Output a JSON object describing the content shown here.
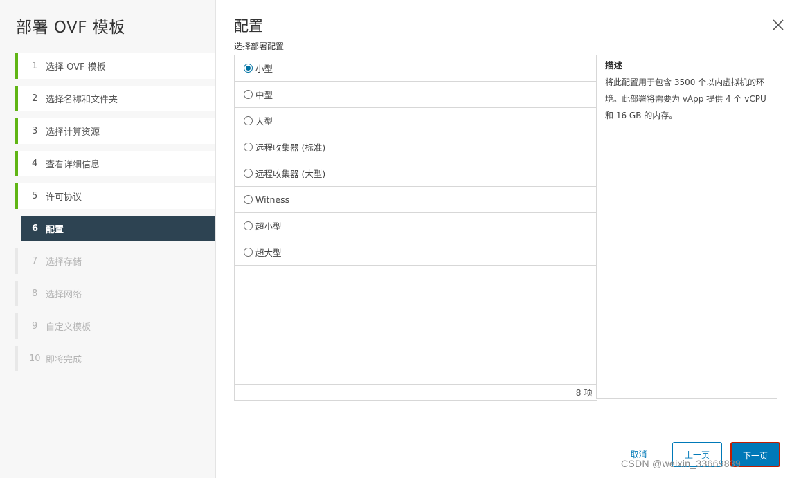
{
  "wizard": {
    "title": "部署 OVF 模板",
    "steps": [
      {
        "num": "1",
        "label": "选择 OVF 模板",
        "state": "done"
      },
      {
        "num": "2",
        "label": "选择名称和文件夹",
        "state": "done"
      },
      {
        "num": "3",
        "label": "选择计算资源",
        "state": "done"
      },
      {
        "num": "4",
        "label": "查看详细信息",
        "state": "done"
      },
      {
        "num": "5",
        "label": "许可协议",
        "state": "done"
      },
      {
        "num": "6",
        "label": "配置",
        "state": "active"
      },
      {
        "num": "7",
        "label": "选择存储",
        "state": "todo"
      },
      {
        "num": "8",
        "label": "选择网络",
        "state": "todo"
      },
      {
        "num": "9",
        "label": "自定义模板",
        "state": "todo"
      },
      {
        "num": "10",
        "label": "即将完成",
        "state": "todo"
      }
    ]
  },
  "main": {
    "title": "配置",
    "subtitle": "选择部署配置",
    "close_icon": "close-icon"
  },
  "configs": {
    "selected_index": 0,
    "options": [
      "小型",
      "中型",
      "大型",
      "远程收集器 (标准)",
      "远程收集器 (大型)",
      "Witness",
      "超小型",
      "超大型"
    ],
    "footer_count": "8 项"
  },
  "description": {
    "title": "描述",
    "body": "将此配置用于包含 3500 个以内虚拟机的环境。此部署将需要为 vApp 提供 4 个 vCPU 和 16 GB 的内存。"
  },
  "buttons": {
    "cancel": "取消",
    "prev": "上一页",
    "next": "下一页"
  },
  "colors": {
    "accent": "#0079b8",
    "done_bar": "#60b515",
    "active_step_bg": "#2d4352"
  },
  "watermark": "CSDN @weixin_33669839"
}
